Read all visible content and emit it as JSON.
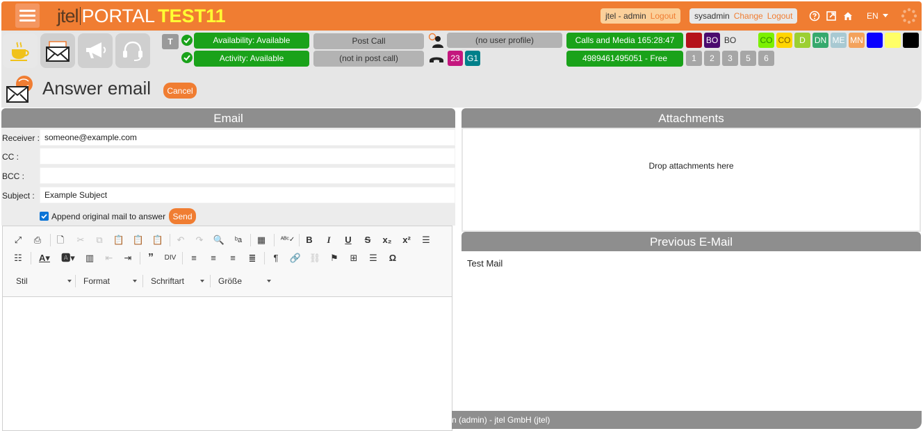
{
  "header": {
    "logo_jtel": "jtel",
    "logo_portal": "PORTAL",
    "logo_instance": "TEST11",
    "user_name": "jtel - admin",
    "user_logout": "Logout",
    "sysadmin_name": "sysadmin",
    "sysadmin_change": "Change",
    "sysadmin_logout": "Logout",
    "language": "EN"
  },
  "status": {
    "t_badge": "T",
    "availability": "Availability: Available",
    "activity": "Activity: Available",
    "post_call": "Post Call",
    "post_call_state": "(not in post call)",
    "user_profile": "(no user profile)",
    "badge_23": "23",
    "badge_g1": "G1",
    "calls_media": "Calls and Media 165:28:47",
    "number_free": "4989461495051 - Free",
    "flags": [
      {
        "label": "",
        "color": "#b5121b"
      },
      {
        "label": "BO",
        "color": "#4b0a6e"
      },
      {
        "label": "BO",
        "color": "transparent"
      }
    ],
    "colored_badges": [
      {
        "label": "CO",
        "color": "#7cf000",
        "text": "#2a8a00"
      },
      {
        "label": "CO",
        "color": "#ffd500",
        "text": "#7a5b00"
      },
      {
        "label": "D",
        "color": "#9ccf32",
        "text": "#ffffff"
      },
      {
        "label": "DN",
        "color": "#36a96d",
        "text": "#ffffff"
      },
      {
        "label": "ME",
        "color": "#a8c9d2",
        "text": "#ffffff"
      },
      {
        "label": "MN",
        "color": "#f3a25c",
        "text": "#ffffff"
      },
      {
        "label": "",
        "color": "#0a00ff",
        "text": "#ffffff"
      },
      {
        "label": "",
        "color": "#ffff66",
        "text": "#ffffff"
      },
      {
        "label": "",
        "color": "#000000",
        "text": "#ffffff"
      }
    ],
    "numbers": [
      "1",
      "2",
      "3",
      "5",
      "6"
    ]
  },
  "page": {
    "title": "Answer email",
    "cancel_label": "Cancel"
  },
  "email": {
    "panel_title": "Email",
    "receiver_label": "Receiver :",
    "receiver_value": "someone@example.com",
    "cc_label": "CC :",
    "cc_value": "",
    "bcc_label": "BCC :",
    "bcc_value": "",
    "subject_label": "Subject :",
    "subject_value": "Example Subject",
    "append_label": "Append original mail to answer",
    "send_label": "Send"
  },
  "editor": {
    "combos": [
      "Stil",
      "Format",
      "Schriftart",
      "Größe"
    ]
  },
  "attachments": {
    "panel_title": "Attachments",
    "drop_text": "Drop attachments here"
  },
  "previous": {
    "panel_title": "Previous E-Mail",
    "body": "Test Mail"
  },
  "footer": {
    "text": "n (admin) - jtel GmbH (jtel)"
  },
  "colors": {
    "accent": "#f07d32",
    "status_green": "#1aa21a",
    "panel_gray": "#8e8e8e"
  }
}
